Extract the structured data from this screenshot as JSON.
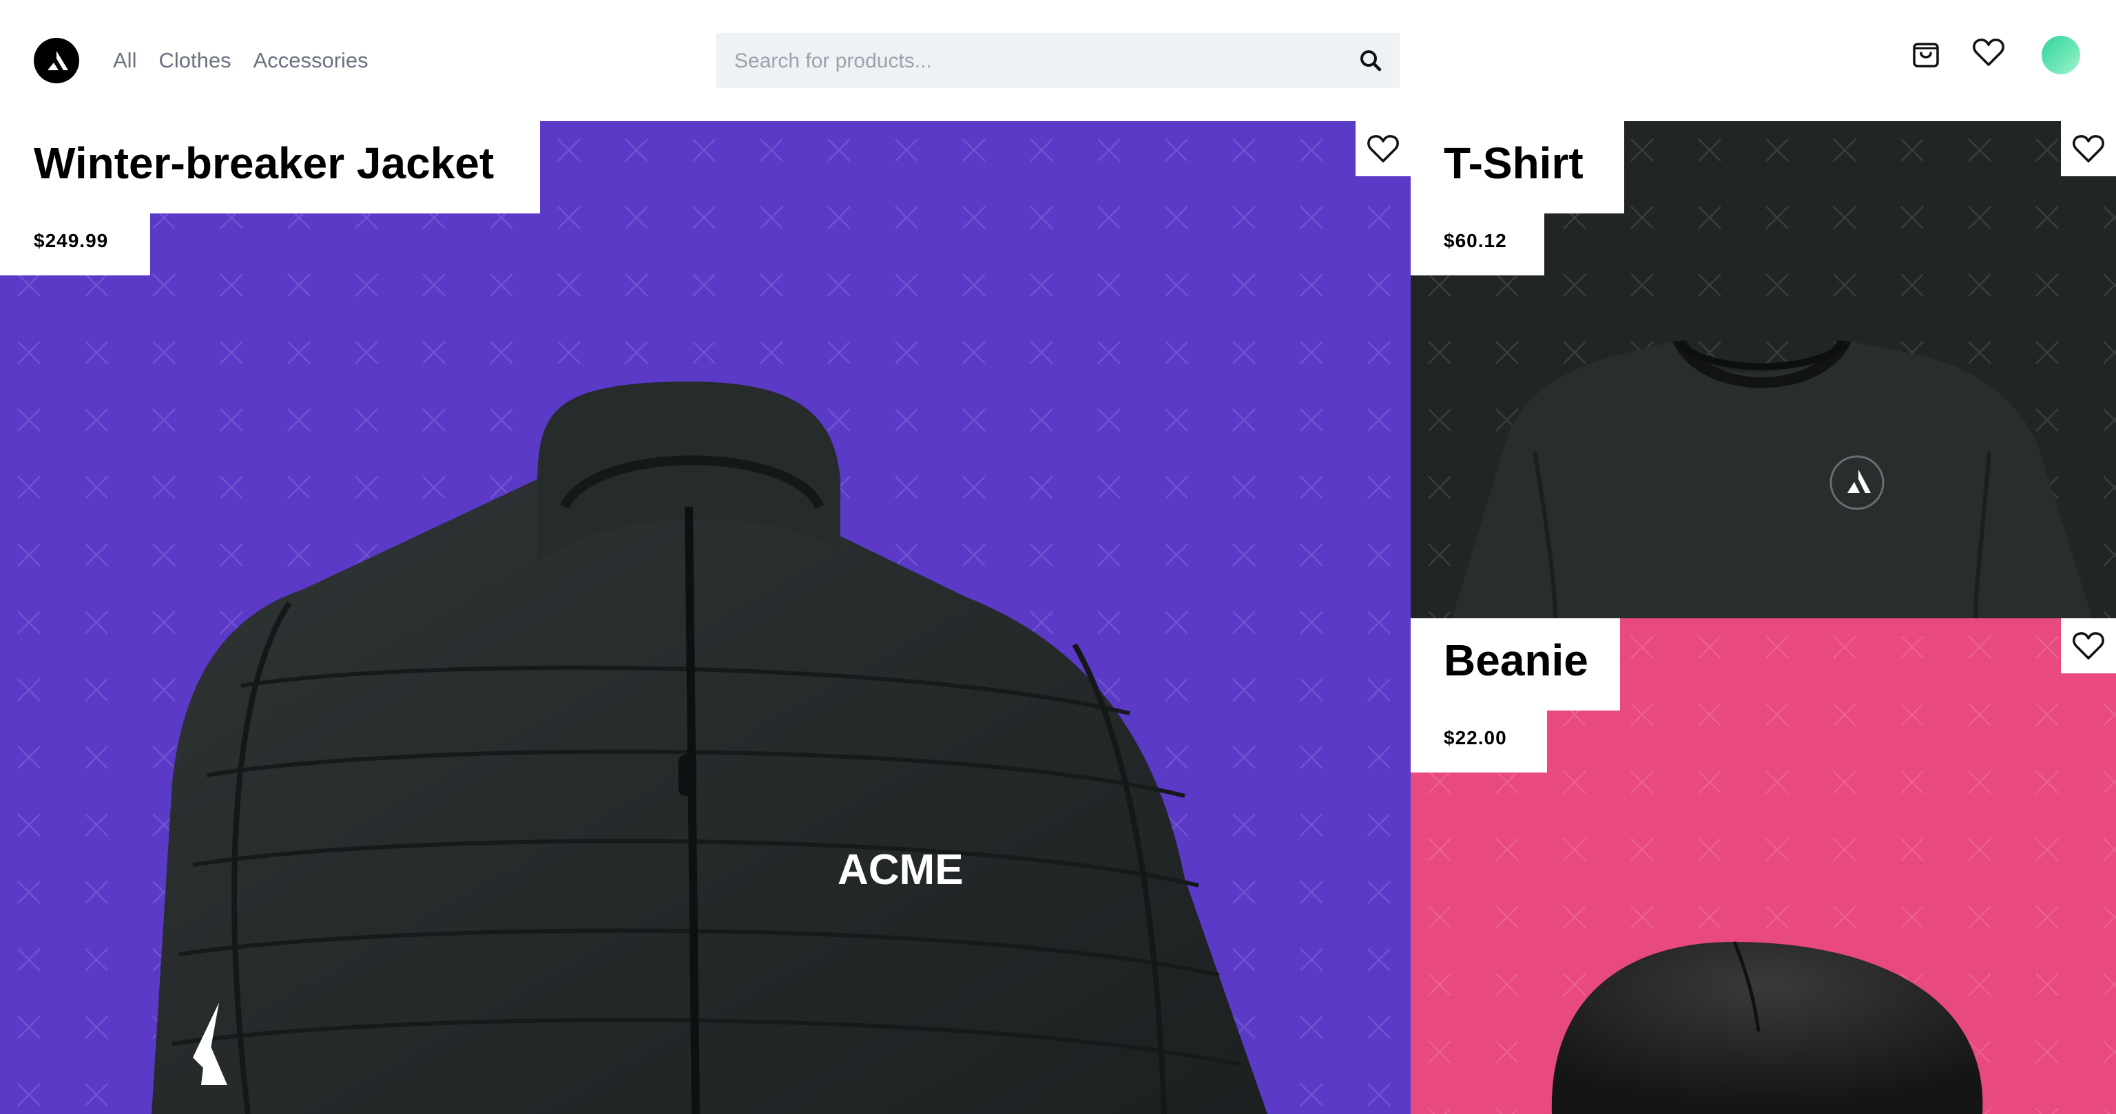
{
  "header": {
    "logo_icon": "acme-logo-icon",
    "nav": [
      {
        "label": "All"
      },
      {
        "label": "Clothes"
      },
      {
        "label": "Accessories"
      }
    ],
    "search": {
      "placeholder": "Search for products...",
      "value": "",
      "icon": "search-icon"
    },
    "cart_icon": "shopping-bag-icon",
    "wishlist_icon": "heart-icon",
    "avatar_color": "#4ade9a"
  },
  "products": [
    {
      "title": "Winter-breaker Jacket",
      "price": "$249.99",
      "background": "#5b3ac8",
      "wishlist_icon": "heart-icon",
      "chest_text": "ACME"
    },
    {
      "title": "T-Shirt",
      "price": "$60.12",
      "background": "#222526",
      "wishlist_icon": "heart-icon"
    },
    {
      "title": "Beanie",
      "price": "$22.00",
      "background": "#e8497f",
      "wishlist_icon": "heart-icon"
    }
  ]
}
